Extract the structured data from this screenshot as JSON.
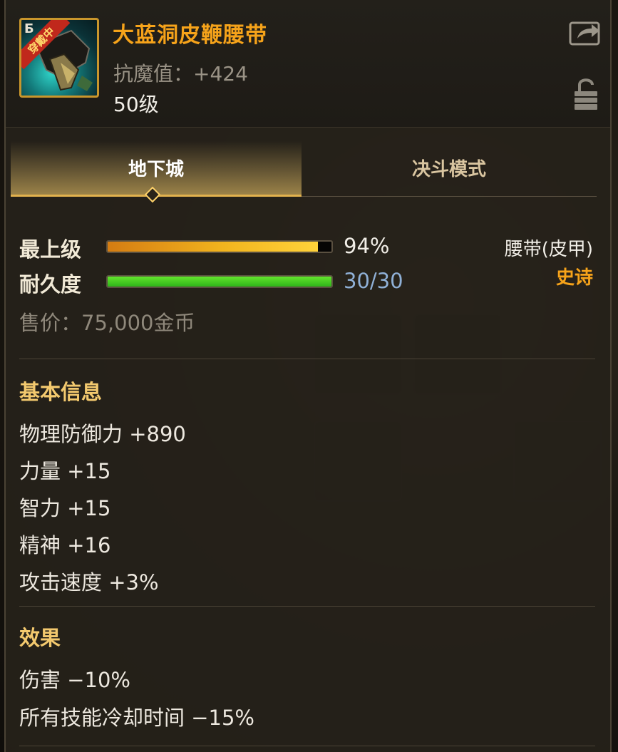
{
  "item": {
    "name": "大蓝洞皮鞭腰带",
    "stat_line": "抗魔值：+424",
    "level_line": "50级",
    "icon_badge": "穿戴中",
    "icon_corner": "Б"
  },
  "tabs": [
    {
      "label": "地下城",
      "active": true
    },
    {
      "label": "决斗模式",
      "active": false
    }
  ],
  "bars": {
    "top_label": "最上级",
    "top_value": "94%",
    "top_fraction": 0.94,
    "durability_label": "耐久度",
    "durability_value": "30/30",
    "durability_fraction": 1.0
  },
  "type": {
    "slot": "腰带(皮甲)",
    "rarity": "史诗"
  },
  "sell_price": "售价：75,000金币",
  "basic_info": {
    "title": "基本信息",
    "lines": [
      "物理防御力 +890",
      "力量 +15",
      "智力 +15",
      "精神 +16",
      "攻击速度 +3%"
    ]
  },
  "effects": {
    "title": "效果",
    "lines": [
      "伤害 −10%",
      "所有技能冷却时间 −15%"
    ]
  },
  "icons": {
    "share": "share-icon",
    "lock": "lock-icon"
  },
  "colors": {
    "item_name": "#f6a31a",
    "rarity": "#f6a31a",
    "durability_text": "#8fb0d6",
    "section_title": "#f3c96e"
  }
}
